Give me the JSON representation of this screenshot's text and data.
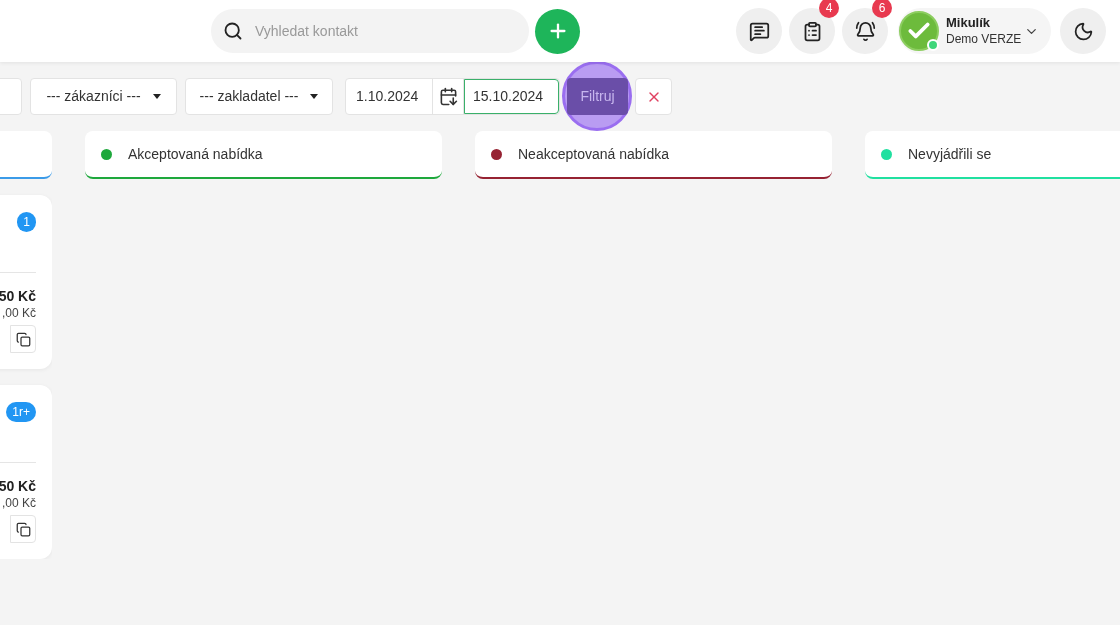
{
  "header": {
    "search": {
      "placeholder": "Vyhledat kontakt"
    },
    "actions": [
      {
        "kind": "messages"
      },
      {
        "kind": "tasks",
        "count": "4"
      },
      {
        "kind": "notifications",
        "count": "6"
      }
    ],
    "user": {
      "name": "Mikulík",
      "subtitle": "Demo VERZE",
      "online": true
    }
  },
  "filters": {
    "dropdowns": [
      {
        "kind": "select"
      },
      {
        "kind": "select",
        "label": "--- zákazníci ---"
      },
      {
        "kind": "select",
        "label": "--- zakladatel ---"
      }
    ],
    "date_from": "1.10.2024",
    "date_to": "15.10.2024",
    "date_to_focused": true,
    "filter_button": {
      "label": "Filtruj",
      "highlighted": true
    }
  },
  "columns": [
    {
      "color": "#3b9be8",
      "cards": [
        {
          "badge": "1",
          "price": "50 Kč",
          "subprice": ",00 Kč"
        },
        {
          "badge": "1r+",
          "price": "50 Kč",
          "subprice": ",00 Kč"
        }
      ]
    },
    {
      "title": "Akceptovaná nabídka",
      "color": "#1ea83c"
    },
    {
      "title": "Neakceptovaná nabídka",
      "color": "#962232"
    },
    {
      "title": "Nevyjádřili se",
      "color": "#20e0a0"
    }
  ]
}
